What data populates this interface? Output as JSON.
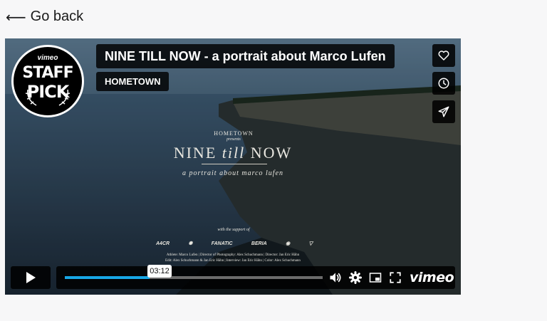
{
  "nav": {
    "back_arrow": "⟵",
    "back_label": "Go back"
  },
  "player": {
    "staff_pick": {
      "brand": "vimeo",
      "line1": "STAFF",
      "line2": "PICK"
    },
    "title": "NINE TILL NOW - a portrait about Marco Lufen",
    "byline": "HOMETOWN",
    "side_buttons": [
      "heart-icon",
      "clock-icon",
      "send-icon"
    ],
    "video_overlay": {
      "studio": "HOMETOWN",
      "presents": "presents",
      "title_a": "NINE ",
      "title_b": "till",
      "title_c": " NOW",
      "subtitle": "a portrait about marco lufen",
      "support": "with the support of",
      "sponsors": [
        "A4CR",
        "✺",
        "FANATIC",
        "BERIA",
        "◉",
        "▽"
      ],
      "credits_line1": "Athlete: Marco Lufen | Director of Photography: Alex Schuchmann | Director: Jan Eric Hähn",
      "credits_line2": "Edit: Alex Schuchmann & Jan Eric Hähn | Interview: Jan Eric Hähn | Color: Alex Schuchmann"
    },
    "controls": {
      "progress": 0.33,
      "time_tooltip": "03:12",
      "logo": "vimeo",
      "accent": "#17a7e6"
    }
  }
}
